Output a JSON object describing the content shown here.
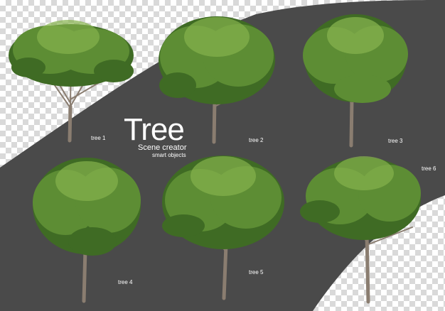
{
  "title": "Tree",
  "subtitle": "Scene creator",
  "tagline": "smart objects",
  "colors": {
    "band": "#4a4a4a",
    "checker": "#d9d9d9",
    "foliage_dark": "#3f6b24",
    "foliage_mid": "#5d8d34",
    "foliage_light": "#86b24d",
    "trunk": "#8a7d70"
  },
  "trees": [
    {
      "label": "tree 1"
    },
    {
      "label": "tree 2"
    },
    {
      "label": "tree 3"
    },
    {
      "label": "tree 4"
    },
    {
      "label": "tree 5"
    },
    {
      "label": "tree 6"
    }
  ]
}
